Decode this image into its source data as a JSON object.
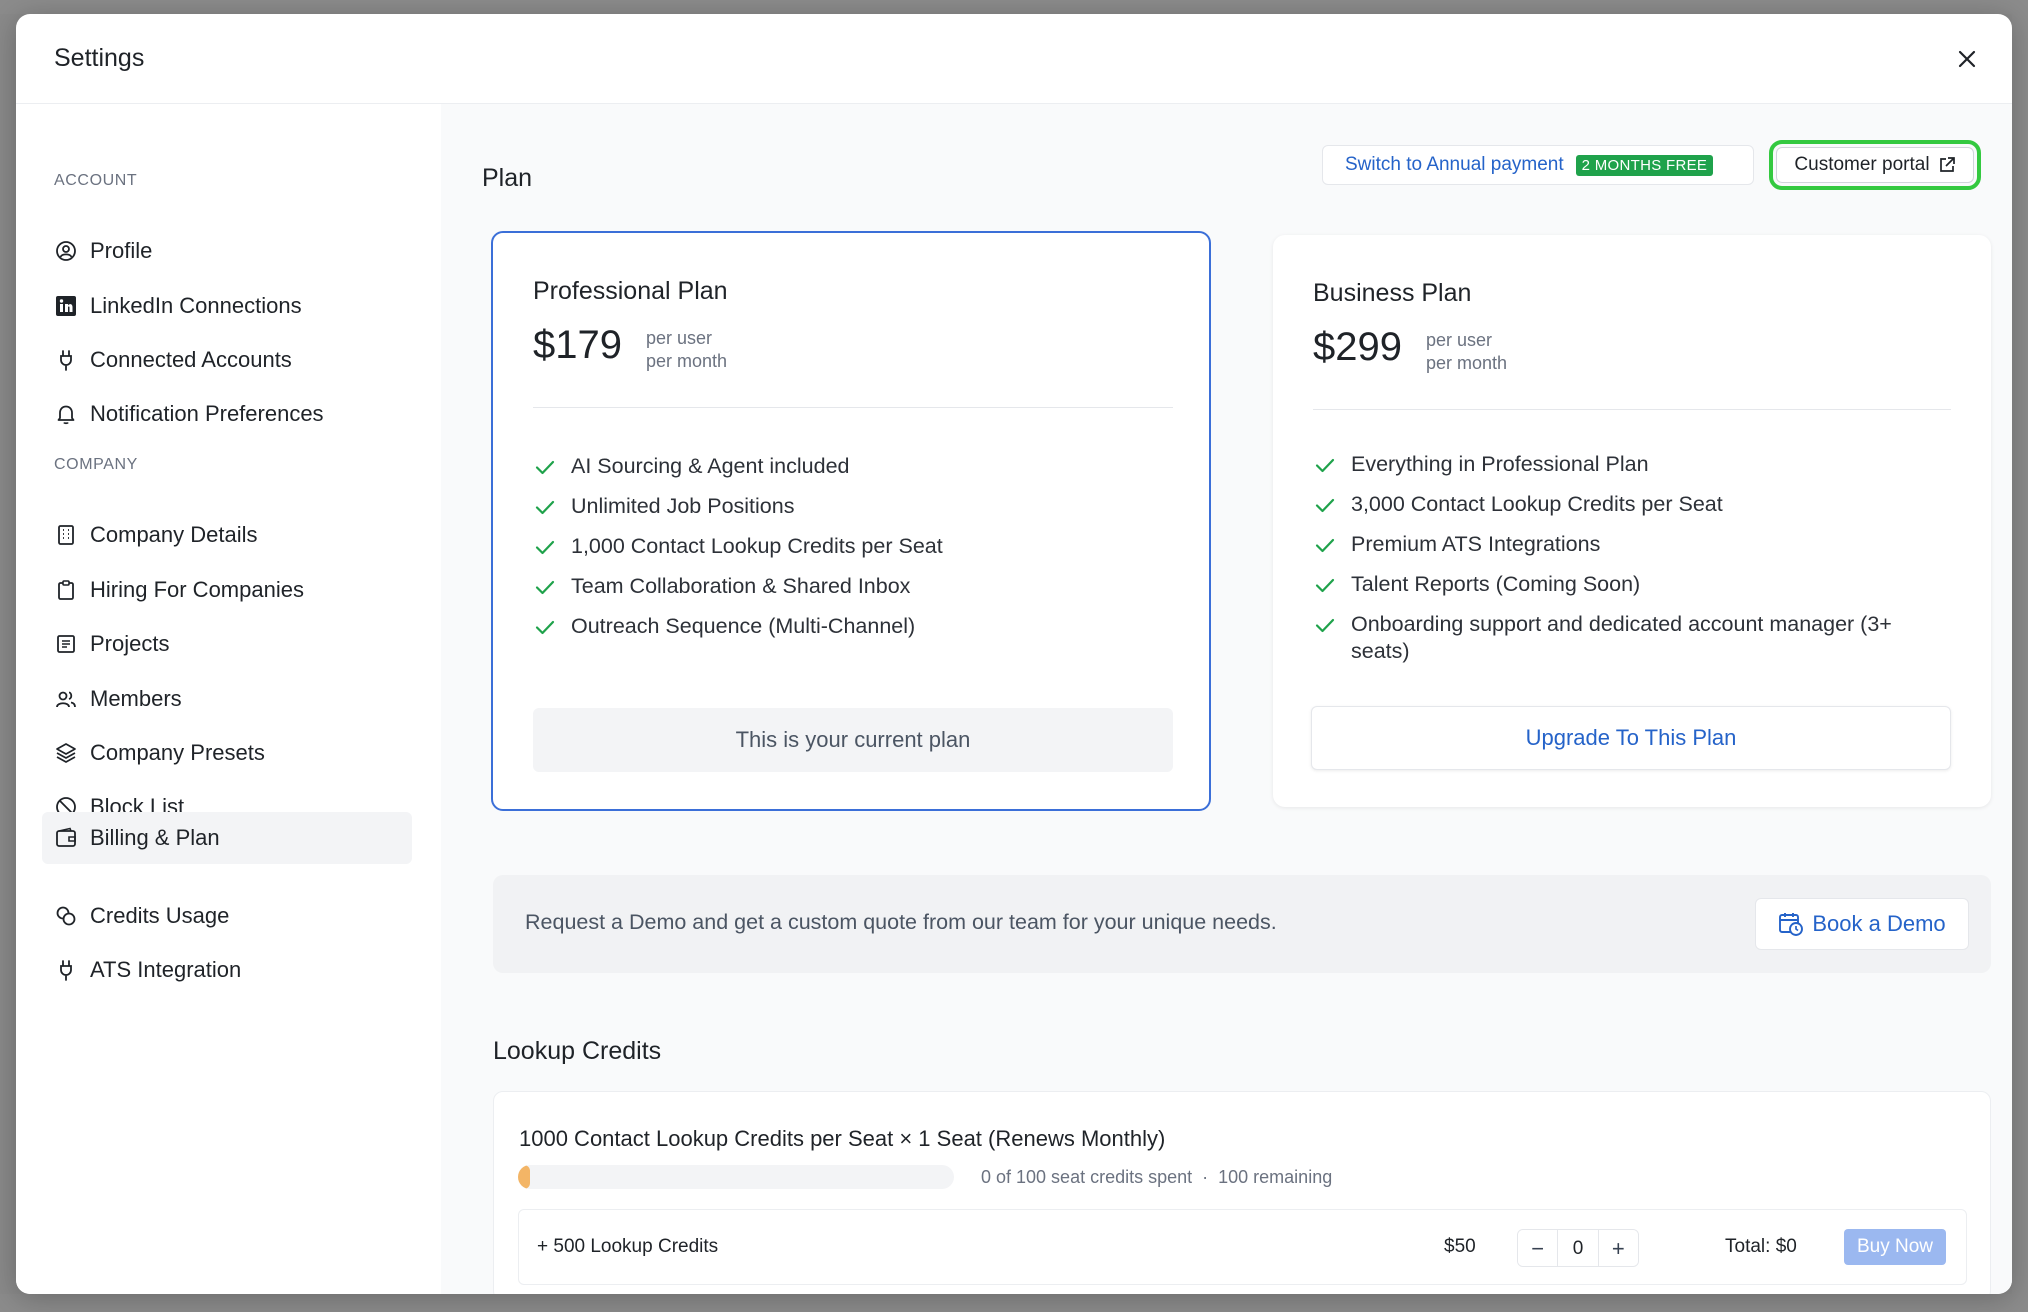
{
  "modal": {
    "title": "Settings"
  },
  "sidebar": {
    "account_label": "ACCOUNT",
    "company_label": "COMPANY",
    "account_items": [
      {
        "label": "Profile",
        "icon": "user-circle-icon"
      },
      {
        "label": "LinkedIn Connections",
        "icon": "linkedin-icon"
      },
      {
        "label": "Connected Accounts",
        "icon": "plug-icon"
      },
      {
        "label": "Notification Preferences",
        "icon": "bell-icon"
      }
    ],
    "company_items": [
      {
        "label": "Company Details",
        "icon": "building-icon"
      },
      {
        "label": "Hiring For Companies",
        "icon": "clipboard-icon"
      },
      {
        "label": "Projects",
        "icon": "list-icon"
      },
      {
        "label": "Members",
        "icon": "users-icon"
      },
      {
        "label": "Company Presets",
        "icon": "layers-icon"
      },
      {
        "label": "Block List",
        "icon": "ban-icon"
      },
      {
        "label": "Billing & Plan",
        "icon": "wallet-icon",
        "active": true
      },
      {
        "label": "Credits Usage",
        "icon": "coins-icon"
      },
      {
        "label": "ATS Integration",
        "icon": "plug-icon"
      }
    ]
  },
  "plan": {
    "heading": "Plan",
    "annual_label": "Switch to Annual payment",
    "annual_badge": "2 MONTHS FREE",
    "portal_label": "Customer portal",
    "professional": {
      "title": "Professional Plan",
      "price": "$179",
      "unit_line1": "per user",
      "unit_line2": "per month",
      "features": [
        "AI Sourcing & Agent included",
        "Unlimited Job Positions",
        "1,000 Contact Lookup Credits per Seat",
        "Team Collaboration & Shared Inbox",
        "Outreach Sequence (Multi-Channel)"
      ],
      "cta": "This is your current plan"
    },
    "business": {
      "title": "Business Plan",
      "price": "$299",
      "unit_line1": "per user",
      "unit_line2": "per month",
      "features": [
        "Everything in Professional Plan",
        "3,000 Contact Lookup Credits per Seat",
        "Premium ATS Integrations",
        "Talent Reports (Coming Soon)",
        "Onboarding support and dedicated account manager (3+ seats)"
      ],
      "cta": "Upgrade To This Plan"
    },
    "demo": {
      "text": "Request a Demo and get a custom quote from our team for your unique needs.",
      "button": "Book a Demo"
    }
  },
  "lookup": {
    "heading": "Lookup Credits",
    "title": "1000 Contact Lookup Credits per Seat × 1 Seat (Renews Monthly)",
    "spent_text": "0 of 100 seat credits spent",
    "separator": "·",
    "remaining_text": "100 remaining",
    "progress_fraction": 0.02,
    "addon": {
      "label": "+ 500 Lookup Credits",
      "price": "$50",
      "minus": "−",
      "quantity": "0",
      "plus": "+",
      "total": "Total: $0",
      "buy": "Buy Now"
    }
  },
  "colors": {
    "accent_blue": "#2563c9",
    "current_border": "#3b6fd8",
    "check_green": "#1fa24b",
    "highlight_green": "#34c940",
    "progress_orange": "#f3b566"
  }
}
